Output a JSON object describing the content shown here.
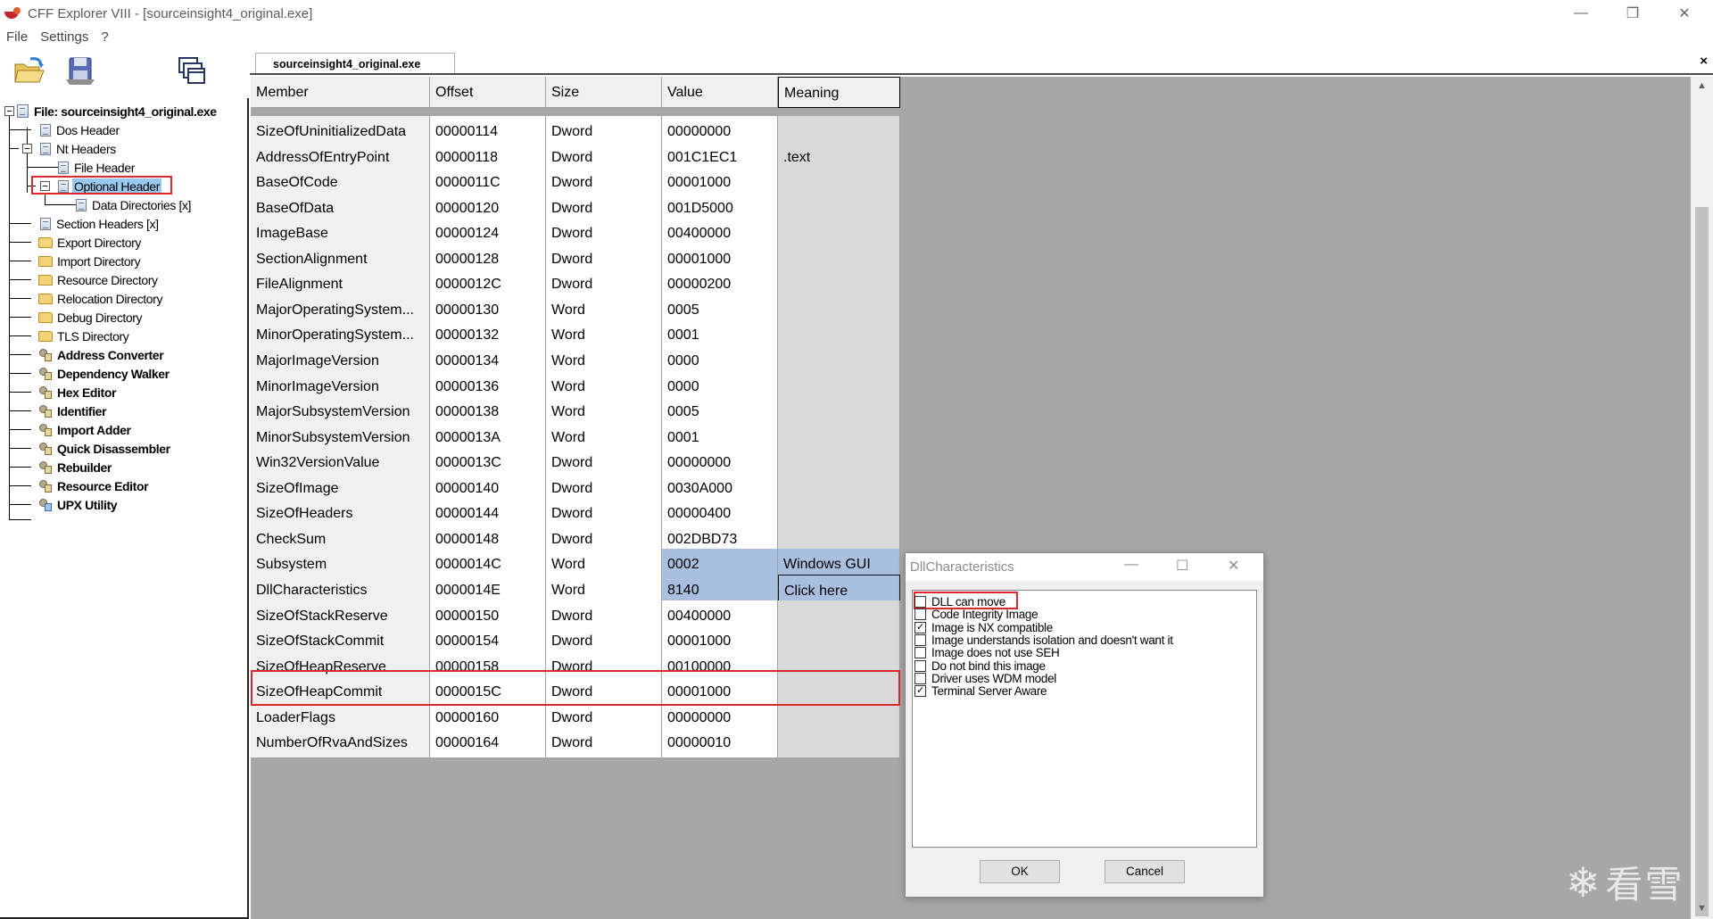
{
  "window": {
    "title": "CFF Explorer VIII - [sourceinsight4_original.exe]"
  },
  "menu": [
    "File",
    "Settings",
    "?"
  ],
  "toolbar": {
    "open_icon": "open-folder-icon",
    "save_icon": "save-disk-icon",
    "windows_icon": "windows-icon"
  },
  "tab": {
    "label": "sourceinsight4_original.exe",
    "close_label": "×"
  },
  "tree": {
    "root": "File: sourceinsight4_original.exe",
    "items": [
      {
        "label": "Dos Header"
      },
      {
        "label": "Nt Headers"
      },
      {
        "label": "File Header"
      },
      {
        "label": "Optional Header"
      },
      {
        "label": "Data Directories [x]"
      },
      {
        "label": "Section Headers [x]"
      },
      {
        "label": "Export Directory"
      },
      {
        "label": "Import Directory"
      },
      {
        "label": "Resource Directory"
      },
      {
        "label": "Relocation Directory"
      },
      {
        "label": "Debug Directory"
      },
      {
        "label": "TLS Directory"
      },
      {
        "label": "Address Converter"
      },
      {
        "label": "Dependency Walker"
      },
      {
        "label": "Hex Editor"
      },
      {
        "label": "Identifier"
      },
      {
        "label": "Import Adder"
      },
      {
        "label": "Quick Disassembler"
      },
      {
        "label": "Rebuilder"
      },
      {
        "label": "Resource Editor"
      },
      {
        "label": "UPX Utility"
      }
    ]
  },
  "table": {
    "headers": [
      "Member",
      "Offset",
      "Size",
      "Value",
      "Meaning"
    ],
    "rows": [
      {
        "member": "SizeOfUninitializedData",
        "offset": "00000114",
        "size": "Dword",
        "value": "00000000",
        "meaning": ""
      },
      {
        "member": "AddressOfEntryPoint",
        "offset": "00000118",
        "size": "Dword",
        "value": "001C1EC1",
        "meaning": ".text"
      },
      {
        "member": "BaseOfCode",
        "offset": "0000011C",
        "size": "Dword",
        "value": "00001000",
        "meaning": ""
      },
      {
        "member": "BaseOfData",
        "offset": "00000120",
        "size": "Dword",
        "value": "001D5000",
        "meaning": ""
      },
      {
        "member": "ImageBase",
        "offset": "00000124",
        "size": "Dword",
        "value": "00400000",
        "meaning": ""
      },
      {
        "member": "SectionAlignment",
        "offset": "00000128",
        "size": "Dword",
        "value": "00001000",
        "meaning": ""
      },
      {
        "member": "FileAlignment",
        "offset": "0000012C",
        "size": "Dword",
        "value": "00000200",
        "meaning": ""
      },
      {
        "member": "MajorOperatingSystem...",
        "offset": "00000130",
        "size": "Word",
        "value": "0005",
        "meaning": ""
      },
      {
        "member": "MinorOperatingSystem...",
        "offset": "00000132",
        "size": "Word",
        "value": "0001",
        "meaning": ""
      },
      {
        "member": "MajorImageVersion",
        "offset": "00000134",
        "size": "Word",
        "value": "0000",
        "meaning": ""
      },
      {
        "member": "MinorImageVersion",
        "offset": "00000136",
        "size": "Word",
        "value": "0000",
        "meaning": ""
      },
      {
        "member": "MajorSubsystemVersion",
        "offset": "00000138",
        "size": "Word",
        "value": "0005",
        "meaning": ""
      },
      {
        "member": "MinorSubsystemVersion",
        "offset": "0000013A",
        "size": "Word",
        "value": "0001",
        "meaning": ""
      },
      {
        "member": "Win32VersionValue",
        "offset": "0000013C",
        "size": "Dword",
        "value": "00000000",
        "meaning": ""
      },
      {
        "member": "SizeOfImage",
        "offset": "00000140",
        "size": "Dword",
        "value": "0030A000",
        "meaning": ""
      },
      {
        "member": "SizeOfHeaders",
        "offset": "00000144",
        "size": "Dword",
        "value": "00000400",
        "meaning": ""
      },
      {
        "member": "CheckSum",
        "offset": "00000148",
        "size": "Dword",
        "value": "002DBD73",
        "meaning": ""
      },
      {
        "member": "Subsystem",
        "offset": "0000014C",
        "size": "Word",
        "value": "0002",
        "meaning": "Windows GUI"
      },
      {
        "member": "DllCharacteristics",
        "offset": "0000014E",
        "size": "Word",
        "value": "8140",
        "meaning": "Click here"
      },
      {
        "member": "SizeOfStackReserve",
        "offset": "00000150",
        "size": "Dword",
        "value": "00400000",
        "meaning": ""
      },
      {
        "member": "SizeOfStackCommit",
        "offset": "00000154",
        "size": "Dword",
        "value": "00001000",
        "meaning": ""
      },
      {
        "member": "SizeOfHeapReserve",
        "offset": "00000158",
        "size": "Dword",
        "value": "00100000",
        "meaning": ""
      },
      {
        "member": "SizeOfHeapCommit",
        "offset": "0000015C",
        "size": "Dword",
        "value": "00001000",
        "meaning": ""
      },
      {
        "member": "LoaderFlags",
        "offset": "00000160",
        "size": "Dword",
        "value": "00000000",
        "meaning": ""
      },
      {
        "member": "NumberOfRvaAndSizes",
        "offset": "00000164",
        "size": "Dword",
        "value": "00000010",
        "meaning": ""
      }
    ]
  },
  "dialog": {
    "title": "DllCharacteristics",
    "options": [
      {
        "label": "DLL can move",
        "checked": false
      },
      {
        "label": "Code Integrity Image",
        "checked": false
      },
      {
        "label": "Image is NX compatible",
        "checked": true
      },
      {
        "label": "Image understands isolation and doesn't want it",
        "checked": false
      },
      {
        "label": "Image does not use SEH",
        "checked": false
      },
      {
        "label": "Do not bind this image",
        "checked": false
      },
      {
        "label": "Driver uses WDM model",
        "checked": false
      },
      {
        "label": "Terminal Server Aware",
        "checked": true
      }
    ],
    "ok_label": "OK",
    "cancel_label": "Cancel"
  },
  "watermark": {
    "text": "看雪"
  },
  "colors": {
    "highlight": "#e0262b",
    "selection": "#99c9ef",
    "value_selection": "#a9bfe0",
    "workspace": "#a7a7a7"
  }
}
